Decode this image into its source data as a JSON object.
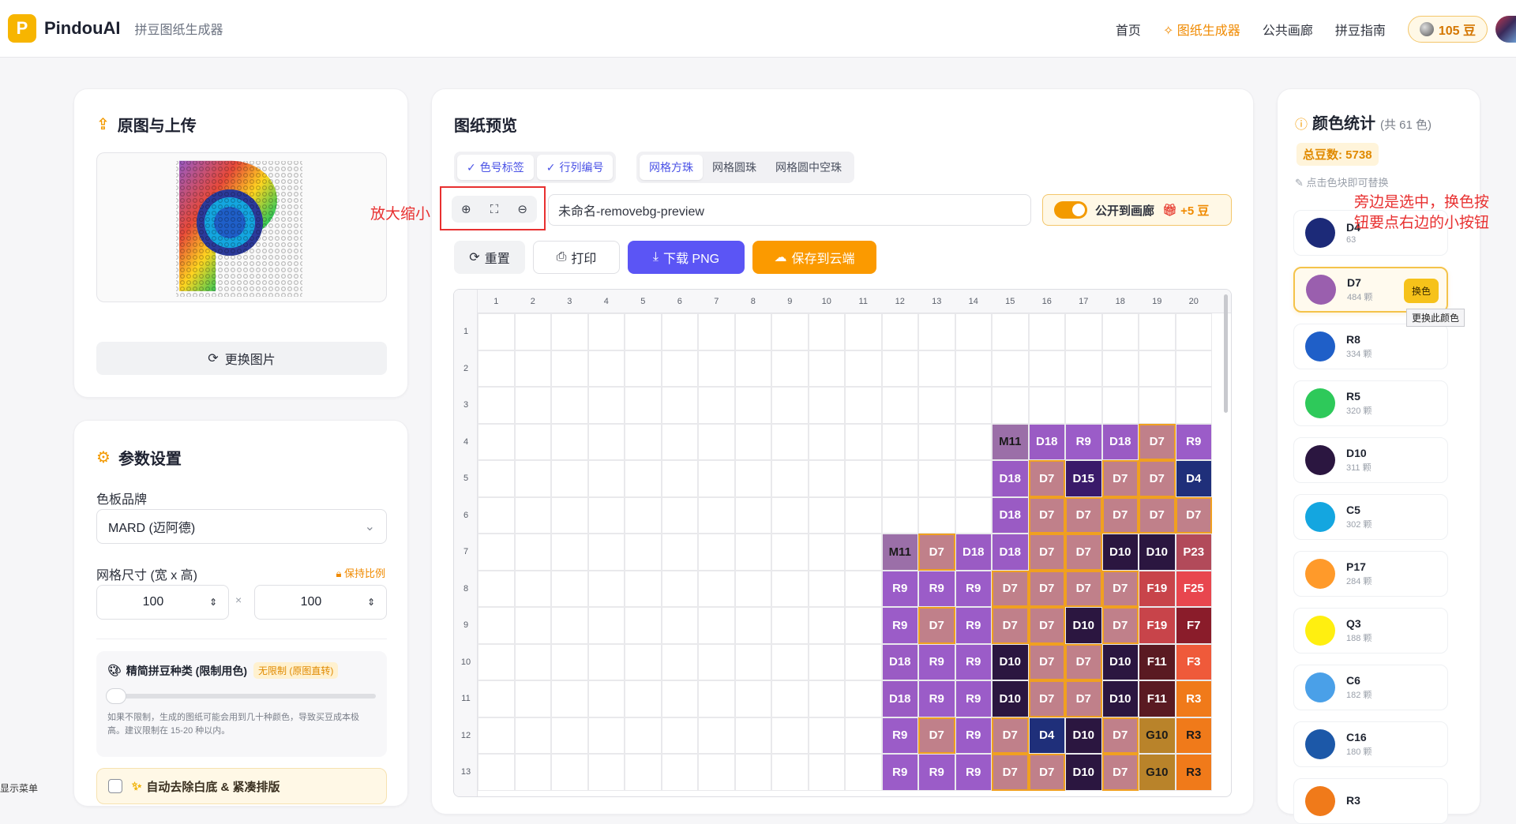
{
  "header": {
    "logo_letter": "P",
    "app_name": "PindouAI",
    "subtitle": "拼豆图纸生成器",
    "nav": [
      "首页",
      "图纸生成器",
      "公共画廊",
      "拼豆指南"
    ],
    "nav_active_index": 1,
    "beans_label": "105 豆"
  },
  "upload_card": {
    "title": "原图与上传",
    "replace_button": "更换图片"
  },
  "params_card": {
    "title": "参数设置",
    "brand_label": "色板品牌",
    "brand_value": "MARD (迈阿德)",
    "grid_size_label": "网格尺寸 (宽 x 高)",
    "keep_ratio": "保持比例",
    "width": "100",
    "height": "100",
    "times": "×",
    "simplify_title": "精简拼豆种类 (限制用色)",
    "simplify_badge": "无限制 (原图直转)",
    "simplify_note": "如果不限制，生成的图纸可能会用到几十种颜色，导致买豆成本极高。建议限制在 15-20 种以内。",
    "auto_remove": "自动去除白底 & 紧凑排版"
  },
  "preview_card": {
    "title": "图纸预览",
    "toggles": [
      "色号标签",
      "行列编号"
    ],
    "modes": [
      "网格方珠",
      "网格圆珠",
      "网格圆中空珠"
    ],
    "active_mode_index": 0,
    "zoom_annotation": "放大缩小",
    "filename": "未命名-removebg-preview",
    "public_label": "公开到画廊",
    "public_bonus": "+5 豆",
    "buttons": {
      "reset": "重置",
      "print": "打印",
      "download": "下载 PNG",
      "cloud": "保存到云端"
    },
    "col_numbers": [
      "1",
      "2",
      "3",
      "4",
      "5",
      "6",
      "7",
      "8",
      "9",
      "10",
      "11",
      "12",
      "13",
      "14",
      "15",
      "16",
      "17",
      "18",
      "19",
      "20"
    ],
    "row_numbers": [
      "1",
      "2",
      "3",
      "4",
      "5",
      "6",
      "7",
      "8",
      "9",
      "10",
      "11",
      "12",
      "13"
    ],
    "cells": [
      {
        "r": 4,
        "c": 15,
        "code": "M11",
        "color": "#9b6fa8",
        "dark": true
      },
      {
        "r": 4,
        "c": 16,
        "code": "D18",
        "color": "#9a5bc4"
      },
      {
        "r": 4,
        "c": 17,
        "code": "R9",
        "color": "#9b5cc8"
      },
      {
        "r": 4,
        "c": 18,
        "code": "D18",
        "color": "#9a5bc4"
      },
      {
        "r": 4,
        "c": 19,
        "code": "D7",
        "color": "#c0808a",
        "sel": true
      },
      {
        "r": 4,
        "c": 20,
        "code": "R9",
        "color": "#9b5cc8"
      },
      {
        "r": 5,
        "c": 15,
        "code": "D18",
        "color": "#9a5bc4"
      },
      {
        "r": 5,
        "c": 16,
        "code": "D7",
        "color": "#c0808a",
        "sel": true
      },
      {
        "r": 5,
        "c": 17,
        "code": "D15",
        "color": "#3a1a6a"
      },
      {
        "r": 5,
        "c": 18,
        "code": "D7",
        "color": "#c0808a",
        "sel": true
      },
      {
        "r": 5,
        "c": 19,
        "code": "D7",
        "color": "#c0808a",
        "sel": true
      },
      {
        "r": 5,
        "c": 20,
        "code": "D4",
        "color": "#1f2f7a"
      },
      {
        "r": 6,
        "c": 15,
        "code": "D18",
        "color": "#9a5bc4"
      },
      {
        "r": 6,
        "c": 16,
        "code": "D7",
        "color": "#c0808a",
        "sel": true
      },
      {
        "r": 6,
        "c": 17,
        "code": "D7",
        "color": "#c0808a",
        "sel": true
      },
      {
        "r": 6,
        "c": 18,
        "code": "D7",
        "color": "#c0808a",
        "sel": true
      },
      {
        "r": 6,
        "c": 19,
        "code": "D7",
        "color": "#c0808a",
        "sel": true
      },
      {
        "r": 6,
        "c": 20,
        "code": "D7",
        "color": "#c0808a",
        "sel": true
      },
      {
        "r": 7,
        "c": 12,
        "code": "M11",
        "color": "#9b6fa8",
        "dark": true
      },
      {
        "r": 7,
        "c": 13,
        "code": "D7",
        "color": "#c0808a",
        "sel": true
      },
      {
        "r": 7,
        "c": 14,
        "code": "D18",
        "color": "#9a5bc4"
      },
      {
        "r": 7,
        "c": 15,
        "code": "D18",
        "color": "#9a5bc4"
      },
      {
        "r": 7,
        "c": 16,
        "code": "D7",
        "color": "#c0808a",
        "sel": true
      },
      {
        "r": 7,
        "c": 17,
        "code": "D7",
        "color": "#c0808a",
        "sel": true
      },
      {
        "r": 7,
        "c": 18,
        "code": "D10",
        "color": "#2b1640"
      },
      {
        "r": 7,
        "c": 19,
        "code": "D10",
        "color": "#2b1640"
      },
      {
        "r": 7,
        "c": 20,
        "code": "P23",
        "color": "#b24a5a"
      },
      {
        "r": 8,
        "c": 12,
        "code": "R9",
        "color": "#9b5cc8"
      },
      {
        "r": 8,
        "c": 13,
        "code": "R9",
        "color": "#9b5cc8"
      },
      {
        "r": 8,
        "c": 14,
        "code": "R9",
        "color": "#9b5cc8"
      },
      {
        "r": 8,
        "c": 15,
        "code": "D7",
        "color": "#c0808a",
        "sel": true
      },
      {
        "r": 8,
        "c": 16,
        "code": "D7",
        "color": "#c0808a",
        "sel": true
      },
      {
        "r": 8,
        "c": 17,
        "code": "D7",
        "color": "#c0808a",
        "sel": true
      },
      {
        "r": 8,
        "c": 18,
        "code": "D7",
        "color": "#c0808a",
        "sel": true
      },
      {
        "r": 8,
        "c": 19,
        "code": "F19",
        "color": "#c8444a"
      },
      {
        "r": 8,
        "c": 20,
        "code": "F25",
        "color": "#e8464e"
      },
      {
        "r": 9,
        "c": 12,
        "code": "R9",
        "color": "#9b5cc8"
      },
      {
        "r": 9,
        "c": 13,
        "code": "D7",
        "color": "#c0808a",
        "sel": true
      },
      {
        "r": 9,
        "c": 14,
        "code": "R9",
        "color": "#9b5cc8"
      },
      {
        "r": 9,
        "c": 15,
        "code": "D7",
        "color": "#c0808a",
        "sel": true
      },
      {
        "r": 9,
        "c": 16,
        "code": "D7",
        "color": "#c0808a",
        "sel": true
      },
      {
        "r": 9,
        "c": 17,
        "code": "D10",
        "color": "#2b1640"
      },
      {
        "r": 9,
        "c": 18,
        "code": "D7",
        "color": "#c0808a",
        "sel": true
      },
      {
        "r": 9,
        "c": 19,
        "code": "F19",
        "color": "#c8444a"
      },
      {
        "r": 9,
        "c": 20,
        "code": "F7",
        "color": "#8a1c2a"
      },
      {
        "r": 10,
        "c": 12,
        "code": "D18",
        "color": "#9a5bc4"
      },
      {
        "r": 10,
        "c": 13,
        "code": "R9",
        "color": "#9b5cc8"
      },
      {
        "r": 10,
        "c": 14,
        "code": "R9",
        "color": "#9b5cc8"
      },
      {
        "r": 10,
        "c": 15,
        "code": "D10",
        "color": "#2b1640"
      },
      {
        "r": 10,
        "c": 16,
        "code": "D7",
        "color": "#c0808a",
        "sel": true
      },
      {
        "r": 10,
        "c": 17,
        "code": "D7",
        "color": "#c0808a",
        "sel": true
      },
      {
        "r": 10,
        "c": 18,
        "code": "D10",
        "color": "#2b1640"
      },
      {
        "r": 10,
        "c": 19,
        "code": "F11",
        "color": "#5a1a22"
      },
      {
        "r": 10,
        "c": 20,
        "code": "F3",
        "color": "#ef5a3a"
      },
      {
        "r": 11,
        "c": 12,
        "code": "D18",
        "color": "#9a5bc4"
      },
      {
        "r": 11,
        "c": 13,
        "code": "R9",
        "color": "#9b5cc8"
      },
      {
        "r": 11,
        "c": 14,
        "code": "R9",
        "color": "#9b5cc8"
      },
      {
        "r": 11,
        "c": 15,
        "code": "D10",
        "color": "#2b1640"
      },
      {
        "r": 11,
        "c": 16,
        "code": "D7",
        "color": "#c0808a",
        "sel": true
      },
      {
        "r": 11,
        "c": 17,
        "code": "D7",
        "color": "#c0808a",
        "sel": true
      },
      {
        "r": 11,
        "c": 18,
        "code": "D10",
        "color": "#2b1640"
      },
      {
        "r": 11,
        "c": 19,
        "code": "F11",
        "color": "#5a1a22"
      },
      {
        "r": 11,
        "c": 20,
        "code": "R3",
        "color": "#f07a1a"
      },
      {
        "r": 12,
        "c": 12,
        "code": "R9",
        "color": "#9b5cc8"
      },
      {
        "r": 12,
        "c": 13,
        "code": "D7",
        "color": "#c0808a",
        "sel": true
      },
      {
        "r": 12,
        "c": 14,
        "code": "R9",
        "color": "#9b5cc8"
      },
      {
        "r": 12,
        "c": 15,
        "code": "D7",
        "color": "#c0808a",
        "sel": true
      },
      {
        "r": 12,
        "c": 16,
        "code": "D4",
        "color": "#1f2f7a"
      },
      {
        "r": 12,
        "c": 17,
        "code": "D10",
        "color": "#2b1640"
      },
      {
        "r": 12,
        "c": 18,
        "code": "D7",
        "color": "#c0808a",
        "sel": true
      },
      {
        "r": 12,
        "c": 19,
        "code": "G10",
        "color": "#b9832a",
        "dark": true
      },
      {
        "r": 12,
        "c": 20,
        "code": "R3",
        "color": "#f07a1a",
        "dark": true
      },
      {
        "r": 13,
        "c": 12,
        "code": "R9",
        "color": "#9b5cc8"
      },
      {
        "r": 13,
        "c": 13,
        "code": "R9",
        "color": "#9b5cc8"
      },
      {
        "r": 13,
        "c": 14,
        "code": "R9",
        "color": "#9b5cc8"
      },
      {
        "r": 13,
        "c": 15,
        "code": "D7",
        "color": "#c0808a",
        "sel": true
      },
      {
        "r": 13,
        "c": 16,
        "code": "D7",
        "color": "#c0808a",
        "sel": true
      },
      {
        "r": 13,
        "c": 17,
        "code": "D10",
        "color": "#2b1640"
      },
      {
        "r": 13,
        "c": 18,
        "code": "D7",
        "color": "#c0808a",
        "sel": true
      },
      {
        "r": 13,
        "c": 19,
        "code": "G10",
        "color": "#b9832a",
        "dark": true
      },
      {
        "r": 13,
        "c": 20,
        "code": "R3",
        "color": "#f07a1a",
        "dark": true
      }
    ]
  },
  "stats_card": {
    "title": "颜色统计",
    "title_count": "(共 61 色)",
    "total": "总豆数: 5738",
    "hint": "点击色块即可替换",
    "annotation": "旁边是选中，换色按钮要点右边的小按钮",
    "swap_button": "换色",
    "swap_tooltip": "更换此颜色",
    "colors": [
      {
        "code": "D4",
        "count": "63",
        "color": "#1c2a78"
      },
      {
        "code": "D7",
        "count": "484 颗",
        "color": "#9a5fae"
      },
      {
        "code": "R8",
        "count": "334 颗",
        "color": "#1f5fc8"
      },
      {
        "code": "R5",
        "count": "320 颗",
        "color": "#2ec95a"
      },
      {
        "code": "D10",
        "count": "311 颗",
        "color": "#2b1640"
      },
      {
        "code": "C5",
        "count": "302 颗",
        "color": "#14a6e0"
      },
      {
        "code": "P17",
        "count": "284 颗",
        "color": "#ff9a2a"
      },
      {
        "code": "Q3",
        "count": "188 颗",
        "color": "#ffef10"
      },
      {
        "code": "C6",
        "count": "182 颗",
        "color": "#4aa0e8"
      },
      {
        "code": "C16",
        "count": "180 颗",
        "color": "#1c58a8"
      },
      {
        "code": "R3",
        "count": "",
        "color": "#f07a1a"
      }
    ],
    "selected_index": 1
  },
  "footer": {
    "show_menu": "显示菜单"
  }
}
